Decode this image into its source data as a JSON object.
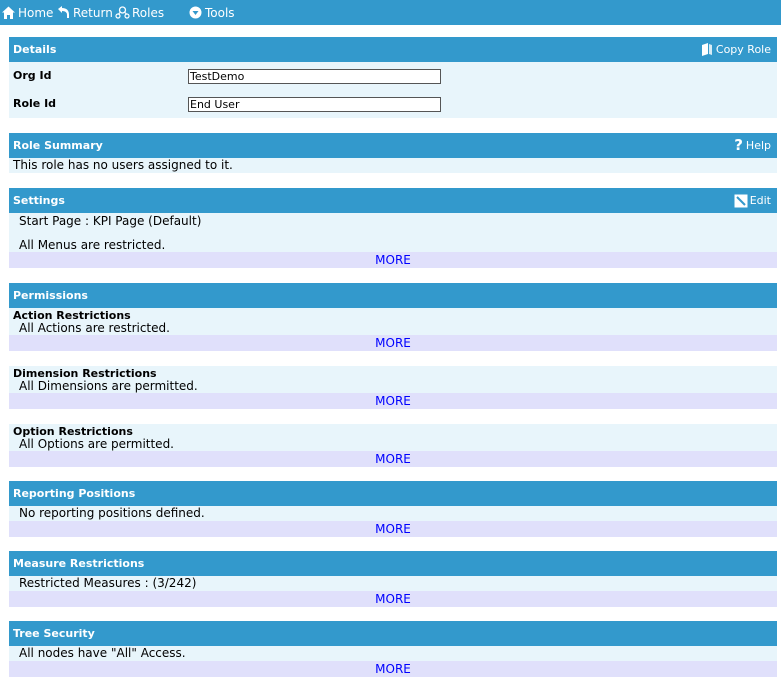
{
  "nav": {
    "home": "Home",
    "return": "Return",
    "roles": "Roles",
    "tools": "Tools"
  },
  "details": {
    "title": "Details",
    "copy_role": "Copy Role",
    "org_id_label": "Org Id",
    "org_id_value": "TestDemo",
    "role_id_label": "Role Id",
    "role_id_value": "End User"
  },
  "role_summary": {
    "title": "Role Summary",
    "help": "Help",
    "text": "This role has no users assigned to it."
  },
  "settings": {
    "title": "Settings",
    "edit": "Edit",
    "start_page": "Start Page : KPI Page (Default)",
    "menus": "All Menus are restricted.",
    "more": "MORE"
  },
  "permissions": {
    "title": "Permissions",
    "action_title": "Action Restrictions",
    "action_text": "All Actions are restricted.",
    "action_more": "MORE",
    "dimension_title": "Dimension Restrictions",
    "dimension_text": "All Dimensions are permitted.",
    "dimension_more": "MORE",
    "option_title": "Option Restrictions",
    "option_text": "All Options are permitted.",
    "option_more": "MORE"
  },
  "reporting_positions": {
    "title": "Reporting Positions",
    "text": "No reporting positions defined.",
    "more": "MORE"
  },
  "measure_restrictions": {
    "title": "Measure Restrictions",
    "text": "Restricted Measures : (3/242)",
    "more": "MORE"
  },
  "tree_security": {
    "title": "Tree Security",
    "text": "All nodes have \"All\" Access.",
    "more": "MORE"
  },
  "colors": {
    "header_blue": "#3399cc",
    "body_bg": "#e8f5fb",
    "more_bg": "#e0e0fb",
    "link": "#0000ff"
  }
}
